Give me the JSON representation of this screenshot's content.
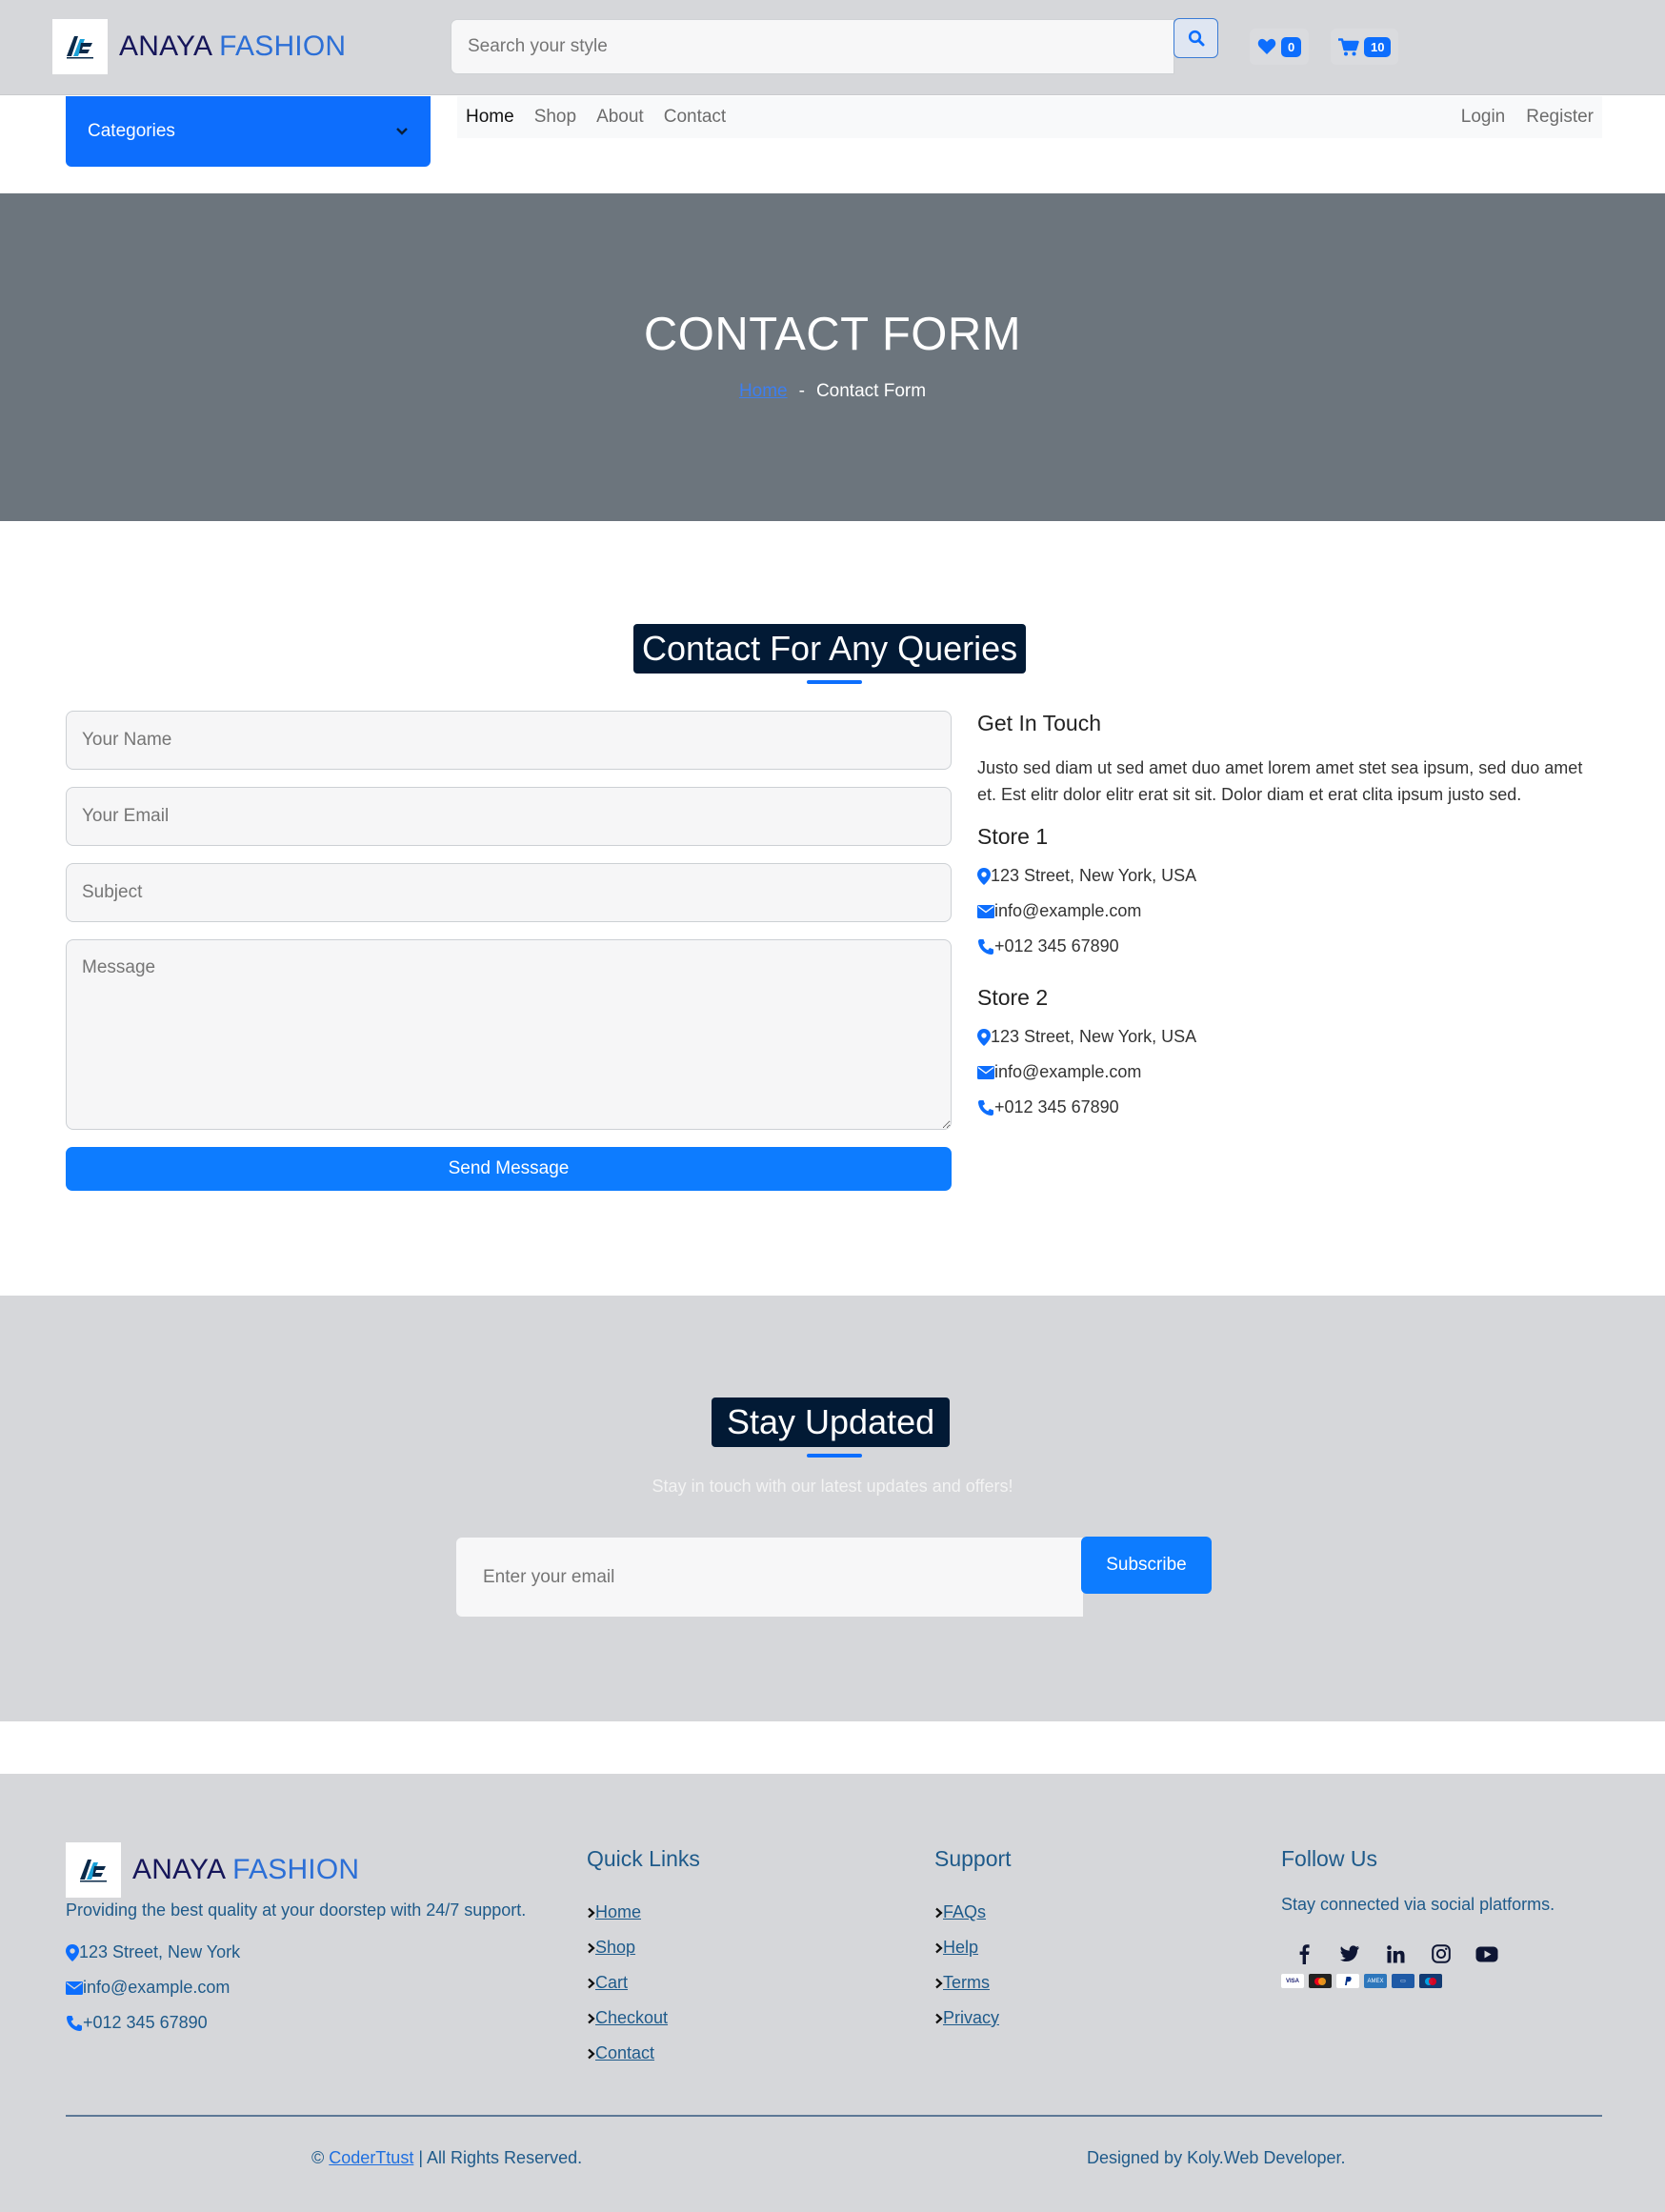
{
  "brand": {
    "part1": "ANAYA",
    "part2": "FASHION"
  },
  "header": {
    "search_placeholder": "Search your style",
    "wishlist_count": "0",
    "cart_count": "10"
  },
  "nav": {
    "categories_label": "Categories",
    "links": [
      "Home",
      "Shop",
      "About",
      "Contact"
    ],
    "auth": [
      "Login",
      "Register"
    ]
  },
  "hero": {
    "title": "CONTACT FORM",
    "breadcrumb_home": "Home",
    "breadcrumb_sep": "-",
    "breadcrumb_current": "Contact Form"
  },
  "contact": {
    "heading": "Contact For Any Queries",
    "name_placeholder": "Your Name",
    "email_placeholder": "Your Email",
    "subject_placeholder": "Subject",
    "message_placeholder": "Message",
    "send_label": "Send Message",
    "get_in_touch": "Get In Touch",
    "intro": "Justo sed diam ut sed amet duo amet lorem amet stet sea ipsum, sed duo amet et. Est elitr dolor elitr erat sit sit. Dolor diam et erat clita ipsum justo sed.",
    "stores": [
      {
        "name": "Store 1",
        "address": "123 Street, New York, USA",
        "email": "info@example.com",
        "phone": "+012 345 67890"
      },
      {
        "name": "Store 2",
        "address": "123 Street, New York, USA",
        "email": "info@example.com",
        "phone": "+012 345 67890"
      }
    ]
  },
  "newsletter": {
    "heading": "Stay Updated",
    "subtitle": "Stay in touch with our latest updates and offers!",
    "email_placeholder": "Enter your email",
    "button_label": "Subscribe"
  },
  "footer": {
    "tagline": "Providing the best quality at your doorstep with 24/7 support.",
    "address": "123 Street, New York",
    "email": "info@example.com",
    "phone": "+012 345 67890",
    "quick_links_title": "Quick Links",
    "quick_links": [
      "Home",
      "Shop",
      "Cart",
      "Checkout",
      "Contact"
    ],
    "support_title": "Support",
    "support_links": [
      "FAQs",
      "Help",
      "Terms",
      "Privacy"
    ],
    "follow_title": "Follow Us",
    "follow_text": "Stay connected via social platforms.",
    "social_icons": [
      "facebook-icon",
      "twitter-icon",
      "linkedin-icon",
      "instagram-icon",
      "youtube-icon"
    ],
    "payment_icons": [
      "visa-icon",
      "mastercard-icon",
      "paypal-icon",
      "amex-icon",
      "payment-card-icon",
      "maestro-icon"
    ],
    "copyright_symbol": "©",
    "copyright_link": "CoderTtust",
    "copyright_rest": "| All Rights Reserved.",
    "designed_by": "Designed by Koly.Web Developer."
  },
  "colors": {
    "primary": "#0d6efd",
    "header_bg": "#d6d7da",
    "hero_bg": "#6c757d",
    "heading_bg": "#021a35",
    "brand_dark": "#16165a",
    "footer_text": "#1e5a8a"
  }
}
